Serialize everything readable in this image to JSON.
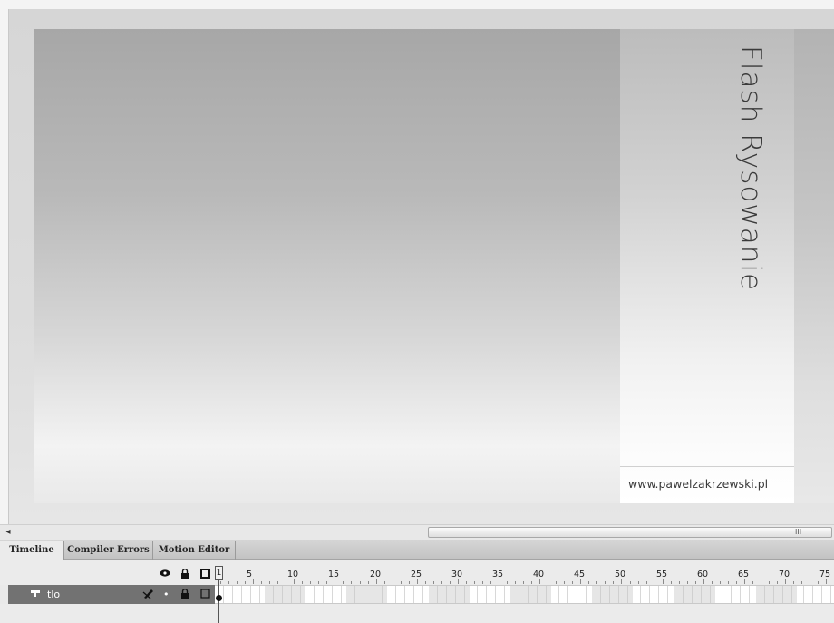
{
  "stage": {
    "title": "Flash Rysowanie",
    "url": "www.pawelzakrzewski.pl"
  },
  "scrollbar": {
    "left_arrow": "◂",
    "grip": "III"
  },
  "panel": {
    "tabs": [
      {
        "label": "Timeline",
        "active": true
      },
      {
        "label": "Compiler Errors",
        "active": false
      },
      {
        "label": "Motion Editor",
        "active": false
      }
    ],
    "header_icons": [
      "eye-icon",
      "lock-icon",
      "outline-icon"
    ],
    "playhead_frame": "1",
    "ruler_numbers": [
      "5",
      "10",
      "15",
      "20",
      "25",
      "30",
      "35",
      "40",
      "45",
      "50",
      "55",
      "60",
      "65",
      "70",
      "75"
    ],
    "layer": {
      "name": "tlo",
      "icon": "layer-icon",
      "edit_icon": "pencil-icon",
      "visible_dot": "•",
      "locked": true
    }
  }
}
